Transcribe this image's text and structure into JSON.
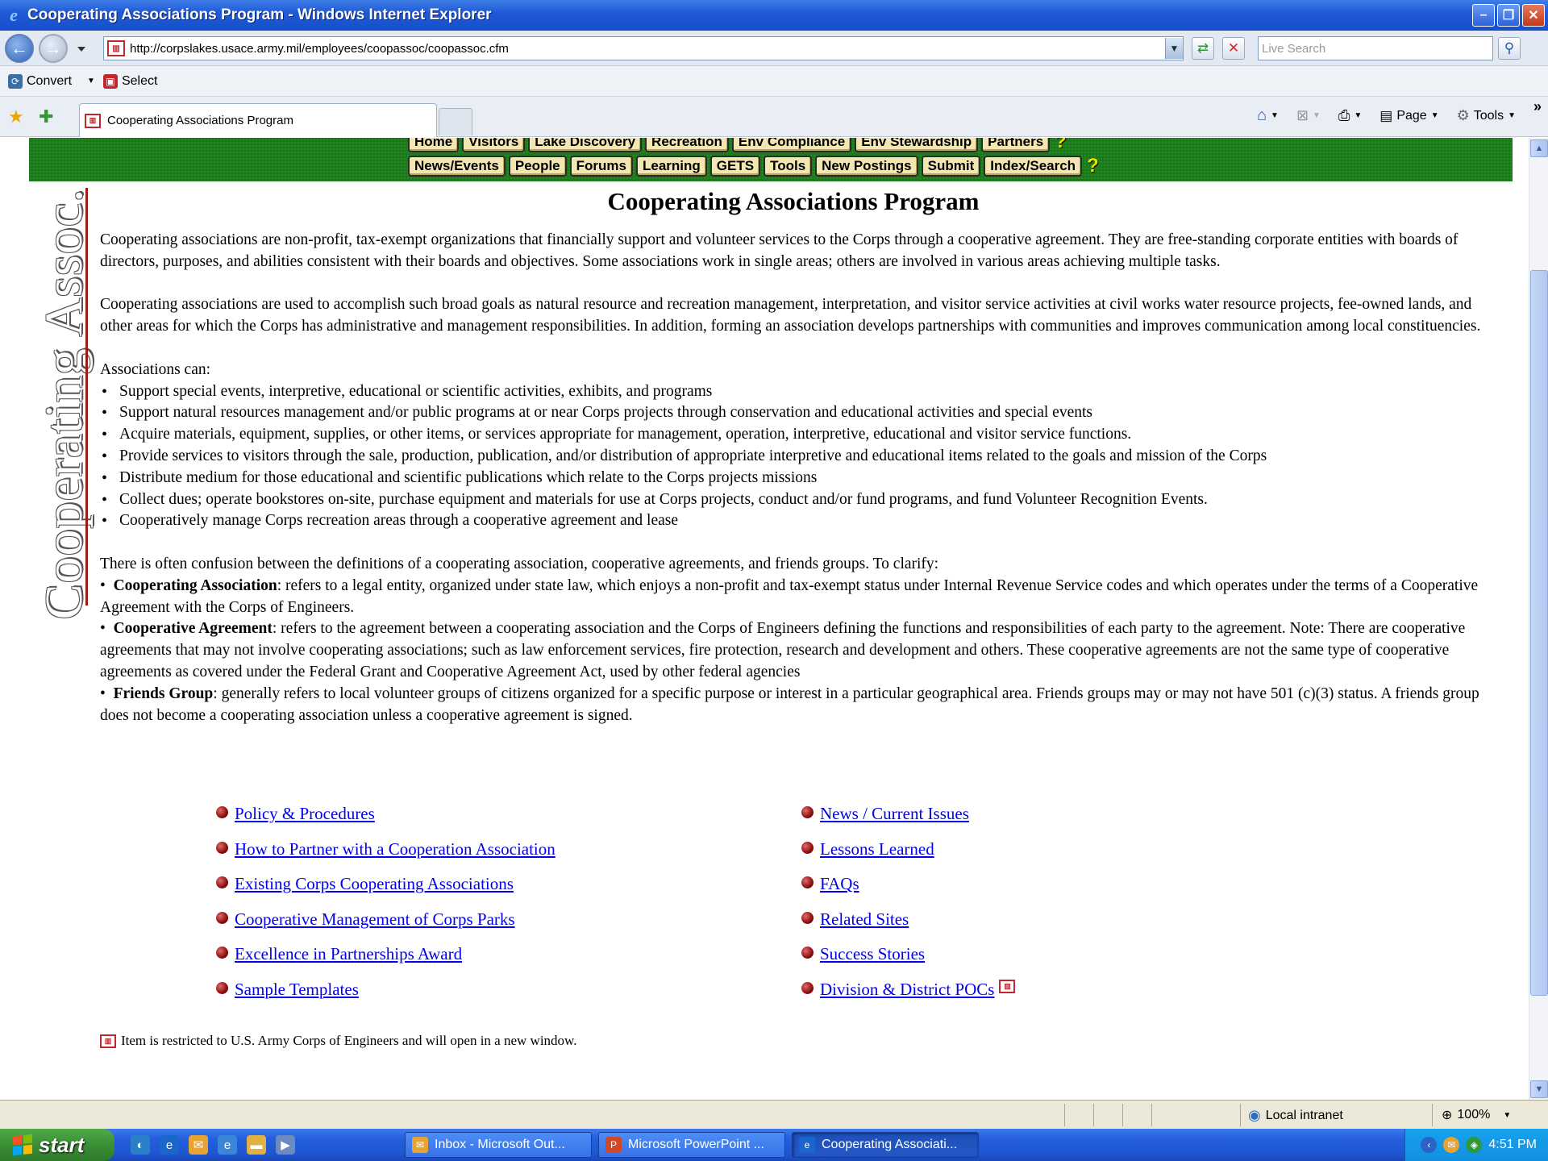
{
  "window": {
    "title": "Cooperating Associations Program - Windows Internet Explorer",
    "minimize": "–",
    "restore": "❐",
    "close": "✕"
  },
  "address_bar": {
    "url": "http://corpslakes.usace.army.mil/employees/coopassoc/coopassoc.cfm",
    "search_placeholder": "Live Search"
  },
  "command_row": {
    "convert": "Convert",
    "select": "Select"
  },
  "tab": {
    "title": "Cooperating Associations Program"
  },
  "command_bar": {
    "page": "Page",
    "tools": "Tools"
  },
  "site_nav": {
    "row1": [
      "Home",
      "Visitors",
      "Lake Discovery",
      "Recreation",
      "Env Compliance",
      "Env Stewardship",
      "Partners"
    ],
    "row2": [
      "News/Events",
      "People",
      "Forums",
      "Learning",
      "GETS",
      "Tools",
      "New Postings",
      "Submit",
      "Index/Search"
    ],
    "help": "?"
  },
  "side_banner": "Cooperating Assoc.",
  "main": {
    "heading": "Cooperating Associations Program",
    "para1": "Cooperating associations are non-profit, tax-exempt organizations that financially support and volunteer services to the Corps through a cooperative agreement. They are free-standing corporate entities with boards of directors, purposes, and abilities consistent with their boards and objectives. Some associations work in single areas; others are involved in various areas achieving multiple tasks.",
    "para2": "Cooperating associations are used to accomplish such broad goals as natural resource and recreation management, interpretation, and visitor service activities at civil works water resource projects, fee-owned lands, and other areas for which the Corps has administrative and management responsibilities. In addition, forming an association develops partnerships with communities and improves communication among local constituencies.",
    "list_intro": "Associations can:",
    "can_list": [
      "Support special events, interpretive, educational or scientific activities, exhibits, and programs",
      "Support natural resources management and/or public programs at or near Corps projects through conservation and educational activities and special events",
      "Acquire materials, equipment, supplies, or other items, or services appropriate for management, operation, interpretive, educational and visitor service functions.",
      "Provide services to visitors through the sale, production, publication, and/or distribution of appropriate interpretive and educational items related to the goals and mission of the Corps",
      "Distribute medium for those educational and scientific publications which relate to the Corps projects missions",
      "Collect dues; operate bookstores on-site, purchase equipment and materials for use at Corps projects, conduct and/or fund programs, and fund Volunteer Recognition Events.",
      "Cooperatively manage Corps recreation areas through a cooperative agreement and lease"
    ],
    "clarify_intro": "There is often confusion between the definitions of a cooperating association, cooperative agreements, and friends groups. To clarify:",
    "definitions": [
      {
        "term": "Cooperating Association",
        "text": ": refers to a legal entity, organized under state law, which enjoys a non-profit and tax-exempt status under Internal Revenue Service codes and which operates under the terms of a Cooperative Agreement with the Corps of Engineers."
      },
      {
        "term": "Cooperative Agreement",
        "text": ": refers to the agreement between a cooperating association and the Corps of Engineers defining the functions and responsibilities of each party to the agreement. Note: There are cooperative agreements that may not involve cooperating associations; such as law enforcement services, fire protection, research and development and others. These cooperative agreements are not the same type of cooperative agreements as covered under the Federal Grant and Cooperative Agreement Act, used by other federal agencies"
      },
      {
        "term": "Friends Group",
        "text": ": generally refers to local volunteer groups of citizens organized for a specific purpose or interest in a particular geographical area. Friends groups may or may not have 501 (c)(3) status. A friends group does not become a cooperating association unless a cooperative agreement is signed."
      }
    ]
  },
  "links_left": [
    "Policy & Procedures",
    "How to Partner with a Cooperation Association",
    "Existing Corps Cooperating Associations",
    "Cooperative Management of Corps Parks",
    "Excellence in Partnerships Award",
    "Sample Templates"
  ],
  "links_right": [
    "News / Current Issues",
    "Lessons Learned",
    "FAQs",
    "Related Sites",
    "Success Stories",
    "Division & District POCs"
  ],
  "footnote": "Item is restricted to U.S. Army Corps of Engineers and will open in a new window.",
  "status_bar": {
    "zone": "Local intranet",
    "zoom": "100%"
  },
  "taskbar": {
    "start": "start",
    "items": [
      "Inbox - Microsoft Out...",
      "Microsoft PowerPoint ...",
      "Cooperating Associati..."
    ],
    "clock": "4:51 PM"
  },
  "colors": {
    "nav_green": "#1a7a1a",
    "nav_button": "#f2e7b0",
    "link": "#0000ee",
    "bullet_ball": "#8a0e0e",
    "side_rule": "#a01818"
  }
}
